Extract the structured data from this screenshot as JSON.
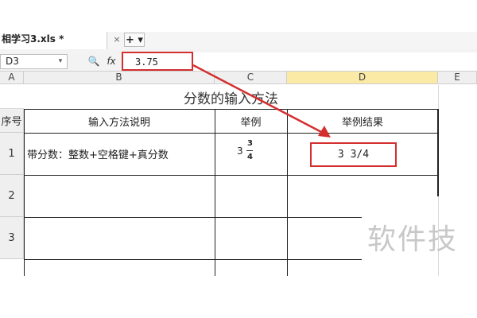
{
  "tab": {
    "file_name": "相学习3.xls *",
    "close_label": "×",
    "add_label": "+ ▾"
  },
  "formula_bar": {
    "cell_ref": "D3",
    "name_dropdown": "▾",
    "zoom_icon": "🔍",
    "fx_label": "fx",
    "value": "3.75"
  },
  "columns": [
    "A",
    "B",
    "C",
    "D",
    "E"
  ],
  "rows": {
    "title_row": "分数的输入方法",
    "header": {
      "no": "序号",
      "method": "输入方法说明",
      "example": "举例",
      "result": "举例结果"
    },
    "data": [
      {
        "no": "1",
        "method": "带分数：整数+空格键+真分数",
        "example_whole": "3",
        "example_num": "3",
        "example_den": "4",
        "result": "3 3/4"
      },
      {
        "no": "2",
        "method": "",
        "example": "",
        "result": ""
      },
      {
        "no": "3",
        "method": "",
        "example": "",
        "result": ""
      }
    ]
  },
  "watermark": "软件技",
  "colors": {
    "accent_red": "#d32f2f",
    "selected_header": "#fbe9a6"
  }
}
